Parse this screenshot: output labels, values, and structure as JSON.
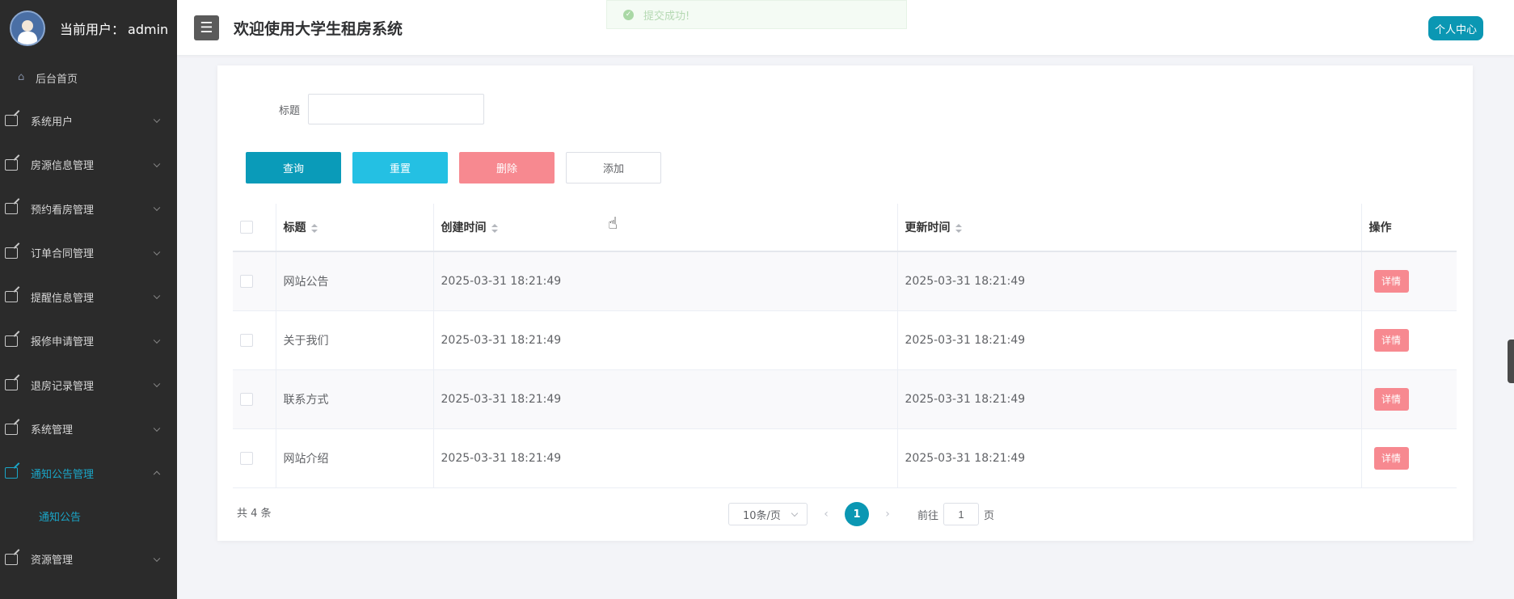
{
  "user": {
    "label": "当前用户：",
    "name": "admin"
  },
  "sidebar": {
    "home": "后台首页",
    "items": [
      {
        "label": "系统用户"
      },
      {
        "label": "房源信息管理"
      },
      {
        "label": "预约看房管理"
      },
      {
        "label": "订单合同管理"
      },
      {
        "label": "提醒信息管理"
      },
      {
        "label": "报修申请管理"
      },
      {
        "label": "退房记录管理"
      },
      {
        "label": "系统管理"
      },
      {
        "label": "通知公告管理"
      },
      {
        "label": "资源管理"
      }
    ],
    "active_sub": "通知公告"
  },
  "header": {
    "toggle_icon": "☰",
    "title": "欢迎使用大学生租房系统",
    "profile_button": "个人中心",
    "toast": "提交成功!"
  },
  "search": {
    "label": "标题",
    "value": "",
    "placeholder": ""
  },
  "buttons": {
    "query": "查询",
    "reset": "重置",
    "delete": "删除",
    "add": "添加"
  },
  "table": {
    "columns": [
      "标题",
      "创建时间",
      "更新时间",
      "操作"
    ],
    "rows": [
      {
        "title": "网站公告",
        "created": "2025-03-31 18:21:49",
        "updated": "2025-03-31 18:21:49",
        "action": "详情"
      },
      {
        "title": "关于我们",
        "created": "2025-03-31 18:21:49",
        "updated": "2025-03-31 18:21:49",
        "action": "详情"
      },
      {
        "title": "联系方式",
        "created": "2025-03-31 18:21:49",
        "updated": "2025-03-31 18:21:49",
        "action": "详情"
      },
      {
        "title": "网站介绍",
        "created": "2025-03-31 18:21:49",
        "updated": "2025-03-31 18:21:49",
        "action": "详情"
      }
    ]
  },
  "pagination": {
    "total": "共 4 条",
    "page_size": "10条/页",
    "prev": "‹",
    "current": "1",
    "next": "›",
    "goto_prefix": "前往",
    "goto_value": "1",
    "goto_suffix": "页"
  },
  "icons": {
    "home": "home-icon",
    "menu": "edit-icon"
  },
  "colors": {
    "accent": "#0b97b3",
    "danger": "#f78990",
    "sidebar_bg": "#2b2b2b"
  }
}
